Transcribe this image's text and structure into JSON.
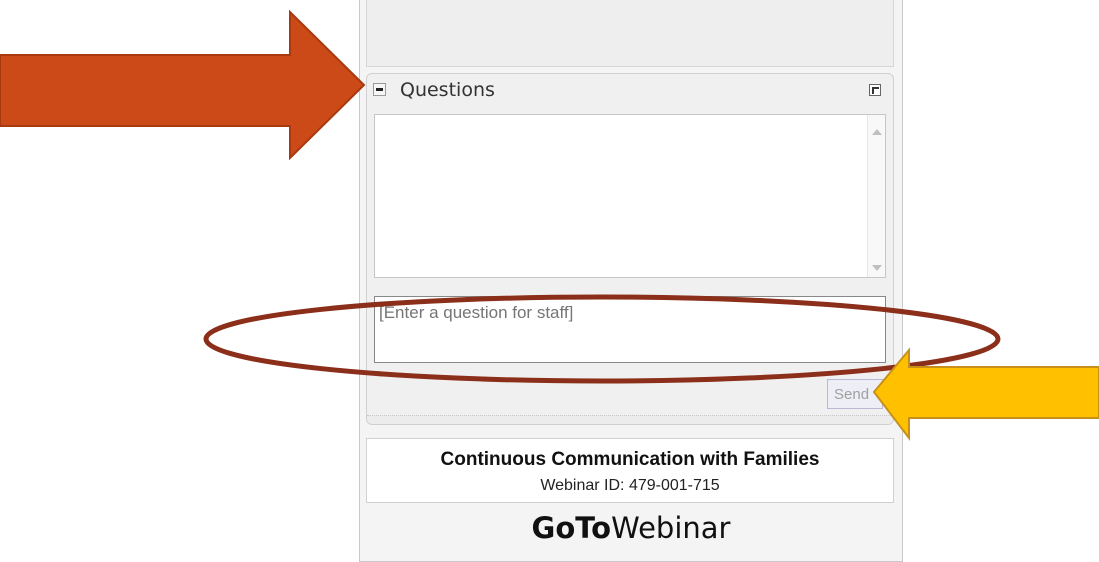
{
  "questions_panel": {
    "title": "Questions",
    "input_placeholder": "[Enter a question for staff]",
    "send_label": "Send"
  },
  "webinar": {
    "title": "Continuous Communication with Families",
    "id_text": "Webinar ID: 479-001-715"
  },
  "brand": {
    "part1": "GoTo",
    "part2": "Webinar"
  },
  "annotations": {
    "left_arrow_color": "#CC4A17",
    "right_arrow_color": "#FFC000",
    "ellipse_color": "#8B2E1A"
  },
  "icons": {
    "collapse": "minus-icon",
    "popout": "popout-icon"
  }
}
